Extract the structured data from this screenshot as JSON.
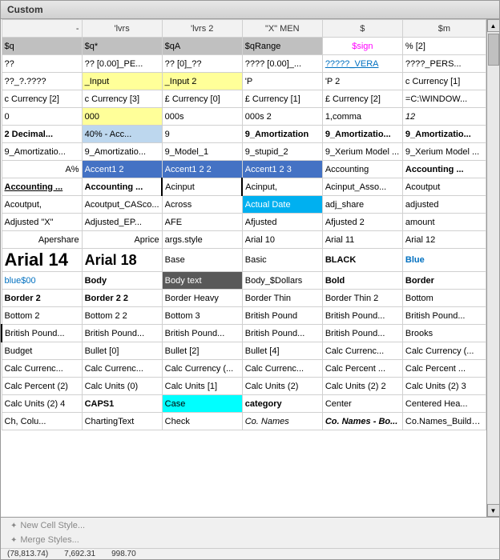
{
  "window": {
    "title": "Custom"
  },
  "header": {
    "cols": [
      "",
      "'lvrs",
      "'lvrs 2",
      "\"X\" MEN",
      "$",
      "$m"
    ]
  },
  "rows": [
    {
      "cells": [
        {
          "text": "$q",
          "style": "cell-gray"
        },
        {
          "text": "$q*",
          "style": "cell-gray"
        },
        {
          "text": "$qA",
          "style": "cell-gray"
        },
        {
          "text": "$qRange",
          "style": "cell-gray"
        },
        {
          "text": "$sign",
          "style": "text-pink",
          "align": "center"
        },
        {
          "text": "% [2]"
        }
      ]
    },
    {
      "cells": [
        {
          "text": "??"
        },
        {
          "text": "?? [0.00]_PE..."
        },
        {
          "text": "?? [0]_??"
        },
        {
          "text": "???? [0.00]_..."
        },
        {
          "text": "?????_VERA",
          "style": "text-underline text-blue"
        },
        {
          "text": "????_PERS..."
        }
      ]
    },
    {
      "cells": [
        {
          "text": "??_?.????"
        },
        {
          "text": "_Input",
          "style": "cell-yellow"
        },
        {
          "text": "_Input 2",
          "style": "cell-yellow"
        },
        {
          "text": "'P"
        },
        {
          "text": "'P 2"
        },
        {
          "text": "c Currency [1]"
        }
      ]
    },
    {
      "cells": [
        {
          "text": "c Currency [2]"
        },
        {
          "text": "c Currency [3]"
        },
        {
          "text": "£ Currency [0]"
        },
        {
          "text": "£ Currency [1]"
        },
        {
          "text": "£ Currency [2]"
        },
        {
          "text": "=C:\\WINDOW..."
        }
      ]
    },
    {
      "cells": [
        {
          "text": "0"
        },
        {
          "text": "000",
          "style": "cell-yellow"
        },
        {
          "text": "000s"
        },
        {
          "text": "000s 2"
        },
        {
          "text": "1,comma"
        },
        {
          "text": "12",
          "style": "text-italic"
        }
      ]
    },
    {
      "cells": [
        {
          "text": "2 Decimal...",
          "style": "text-bold"
        },
        {
          "text": "40% - Acc...",
          "style": "cell-light-blue"
        },
        {
          "text": "9"
        },
        {
          "text": "9_Amortization",
          "style": "text-bold"
        },
        {
          "text": "9_Amortizatio...",
          "style": "text-bold"
        },
        {
          "text": "9_Amortizatio...",
          "style": "text-bold"
        }
      ]
    },
    {
      "cells": [
        {
          "text": "9_Amortizatio..."
        },
        {
          "text": "9_Amortizatio..."
        },
        {
          "text": "9_Model_1"
        },
        {
          "text": "9_stupid_2"
        },
        {
          "text": "9_Xerium Model ..."
        },
        {
          "text": "9_Xerium Model ..."
        }
      ]
    },
    {
      "cells": [
        {
          "text": "A%",
          "align": "right"
        },
        {
          "text": "Accent1 2",
          "style": "cell-blue"
        },
        {
          "text": "Accent1 2 2",
          "style": "cell-blue"
        },
        {
          "text": "Accent1 2 3",
          "style": "cell-blue"
        },
        {
          "text": "Accounting"
        },
        {
          "text": "Accounting ...",
          "style": "text-bold"
        }
      ]
    },
    {
      "cells": [
        {
          "text": "Accounting ...",
          "style": "text-underline text-bold"
        },
        {
          "text": "Accounting ...",
          "style": "text-bold"
        },
        {
          "text": "Acinput",
          "style": "cell-border-left cell-border-right"
        },
        {
          "text": "Acinput,"
        },
        {
          "text": "Acinput_Asso..."
        },
        {
          "text": "Acoutput"
        }
      ]
    },
    {
      "cells": [
        {
          "text": "Acoutput,"
        },
        {
          "text": "Acoutput_CASco..."
        },
        {
          "text": "Across"
        },
        {
          "text": "Actual Date",
          "style": "cell-teal"
        },
        {
          "text": "adj_share"
        },
        {
          "text": "adjusted"
        }
      ]
    },
    {
      "cells": [
        {
          "text": "Adjusted \"X\""
        },
        {
          "text": "Adjusted_EP..."
        },
        {
          "text": "AFE"
        },
        {
          "text": "Afjusted"
        },
        {
          "text": "Afjusted 2"
        },
        {
          "text": "amount"
        }
      ]
    },
    {
      "cells": [
        {
          "text": "Apershare",
          "align": "right"
        },
        {
          "text": "Aprice",
          "align": "right"
        },
        {
          "text": "args.style"
        },
        {
          "text": "Arial 10"
        },
        {
          "text": "Arial 11"
        },
        {
          "text": "Arial 12"
        }
      ]
    },
    {
      "cells": [
        {
          "text": "Arial 14",
          "style": "text-xlarge"
        },
        {
          "text": "Arial 18",
          "style": "text-large"
        },
        {
          "text": "Base"
        },
        {
          "text": "Basic"
        },
        {
          "text": "BLACK",
          "style": "text-bold"
        },
        {
          "text": "Blue",
          "style": "text-blue text-bold"
        }
      ]
    },
    {
      "cells": [
        {
          "text": "blue$00",
          "style": "text-blue"
        },
        {
          "text": "Body",
          "style": "text-bold"
        },
        {
          "text": "Body text",
          "style": "cell-darkgray"
        },
        {
          "text": "Body_$Dollars"
        },
        {
          "text": "Bold",
          "style": "text-bold"
        },
        {
          "text": "Border",
          "style": "text-bold"
        }
      ]
    },
    {
      "cells": [
        {
          "text": "Border 2",
          "style": "text-bold"
        },
        {
          "text": "Border 2 2",
          "style": "text-bold"
        },
        {
          "text": "Border Heavy"
        },
        {
          "text": "Border Thin"
        },
        {
          "text": "Border Thin 2"
        },
        {
          "text": "Bottom"
        }
      ]
    },
    {
      "cells": [
        {
          "text": "Bottom 2"
        },
        {
          "text": "Bottom 2 2"
        },
        {
          "text": "Bottom 3"
        },
        {
          "text": "British Pound"
        },
        {
          "text": "British Pound..."
        },
        {
          "text": "British Pound..."
        }
      ]
    },
    {
      "cells": [
        {
          "text": "British Pound...",
          "style": "cell-border-left"
        },
        {
          "text": "British Pound..."
        },
        {
          "text": "British Pound..."
        },
        {
          "text": "British Pound..."
        },
        {
          "text": "British Pound..."
        },
        {
          "text": "Brooks"
        }
      ]
    },
    {
      "cells": [
        {
          "text": "Budget"
        },
        {
          "text": "Bullet [0]"
        },
        {
          "text": "Bullet [2]"
        },
        {
          "text": "Bullet [4]"
        },
        {
          "text": "Calc Currenc..."
        },
        {
          "text": "Calc Currency (..."
        }
      ]
    },
    {
      "cells": [
        {
          "text": "Calc Currenc..."
        },
        {
          "text": "Calc Currenc..."
        },
        {
          "text": "Calc Currency (..."
        },
        {
          "text": "Calc Currenc..."
        },
        {
          "text": "Calc Percent ..."
        },
        {
          "text": "Calc Percent ..."
        }
      ]
    },
    {
      "cells": [
        {
          "text": "Calc Percent (2)"
        },
        {
          "text": "Calc Units (0)"
        },
        {
          "text": "Calc Units [1]"
        },
        {
          "text": "Calc Units (2)"
        },
        {
          "text": "Calc Units (2) 2"
        },
        {
          "text": "Calc Units (2) 3"
        }
      ]
    },
    {
      "cells": [
        {
          "text": "Calc Units (2) 4"
        },
        {
          "text": "CAPS1",
          "style": "text-bold"
        },
        {
          "text": "Case",
          "style": "cell-cyan"
        },
        {
          "text": "category",
          "style": "text-bold"
        },
        {
          "text": "Center"
        },
        {
          "text": "Centered Hea..."
        }
      ]
    },
    {
      "cells": [
        {
          "text": "Ch, Colu..."
        },
        {
          "text": "ChartingText"
        },
        {
          "text": "Check"
        },
        {
          "text": "Co. Names",
          "style": "text-italic"
        },
        {
          "text": "Co. Names - Bo...",
          "style": "text-bold text-italic"
        },
        {
          "text": "Co.Names_Buildup..."
        }
      ]
    }
  ],
  "bottom_buttons": [
    {
      "label": "New Cell Style...",
      "icon": "✦"
    },
    {
      "label": "Merge Styles...",
      "icon": "✦"
    }
  ],
  "status_bar": {
    "values": [
      "(78,813.74)",
      "7,692.31",
      "998.70"
    ]
  },
  "scrollbar": {
    "up_arrow": "▲",
    "down_arrow": "▼"
  }
}
